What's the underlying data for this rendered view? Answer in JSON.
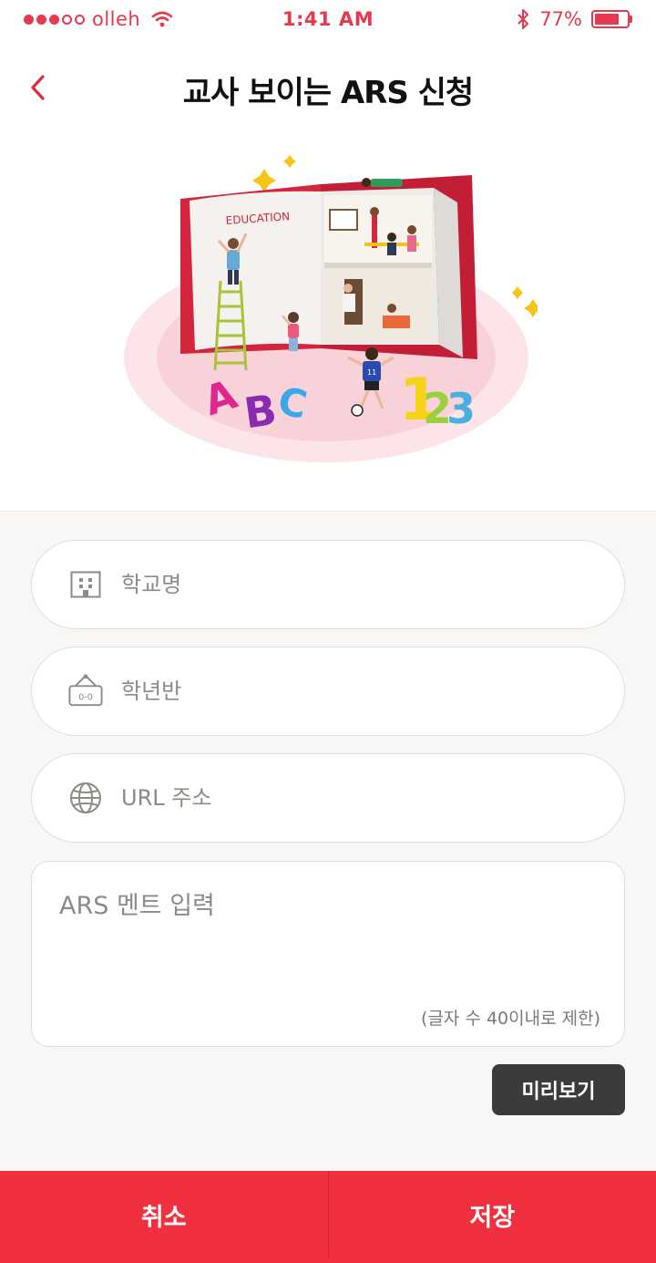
{
  "status_bar": {
    "carrier": "olleh",
    "time": "1:41 AM",
    "battery": "77%",
    "battery_level": 0.77,
    "color": "#e8384f"
  },
  "header": {
    "title": "교사 보이는 ARS 신청",
    "back_icon": "chevron-left-icon"
  },
  "hero": {
    "book_label": "EDUCATION",
    "letters": "ABC",
    "numbers": "123"
  },
  "form": {
    "school_name": {
      "placeholder": "학교명",
      "icon": "building-icon"
    },
    "grade_class": {
      "placeholder": "학년반",
      "icon": "class-sign-icon",
      "icon_text": "0-0"
    },
    "url": {
      "placeholder": "URL 주소",
      "icon": "globe-icon"
    },
    "ars_message": {
      "placeholder": "ARS 멘트 입력",
      "limit_note": "(글자 수 40이내로 제한)"
    },
    "preview_label": "미리보기"
  },
  "bottom_bar": {
    "cancel_label": "취소",
    "save_label": "저장",
    "color": "#f0303f"
  }
}
